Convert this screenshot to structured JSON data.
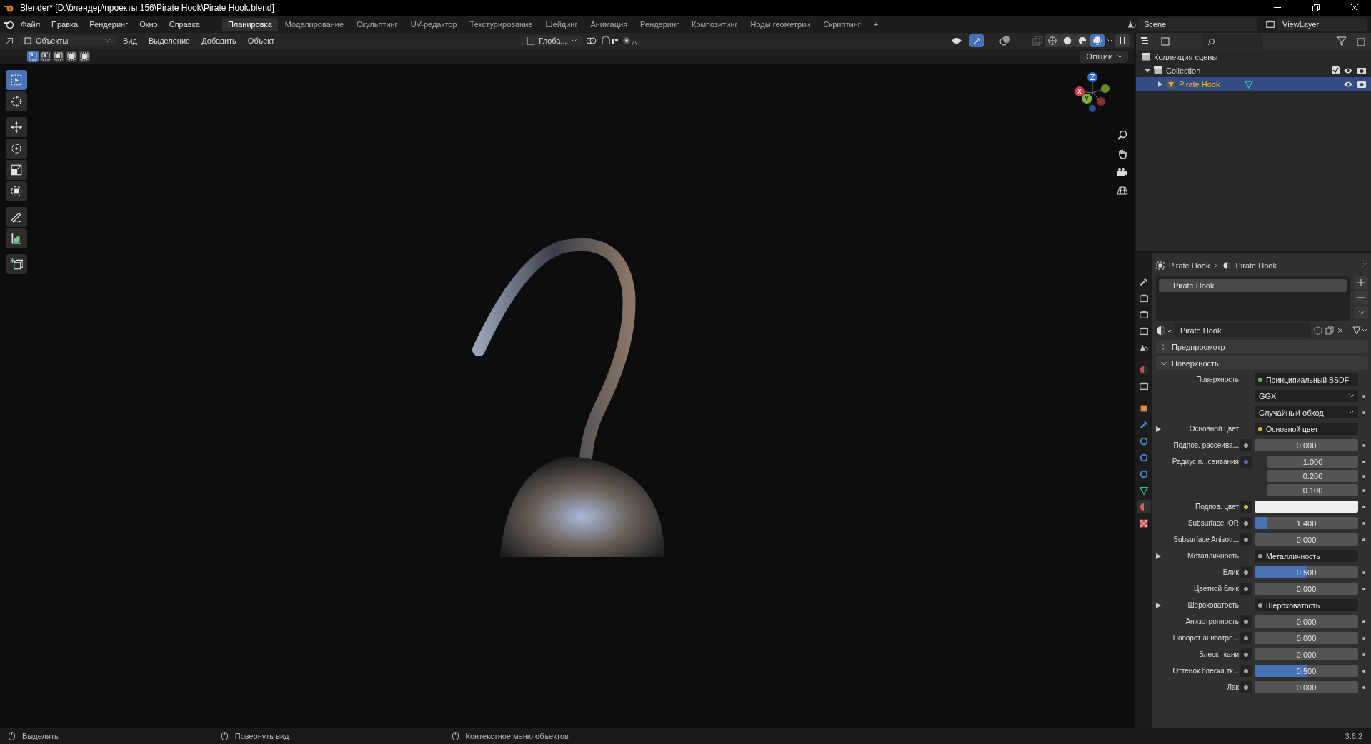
{
  "window": {
    "title": "Blender* [D:\\блендер\\проекты 156\\Pirate Hook\\Pirate Hook.blend]"
  },
  "menu": [
    "Файл",
    "Правка",
    "Рендеринг",
    "Окно",
    "Справка"
  ],
  "workspaces": [
    {
      "label": "Планировка",
      "selected": true
    },
    {
      "label": "Моделирование",
      "selected": false
    },
    {
      "label": "Скульптинг",
      "selected": false
    },
    {
      "label": "UV-редактор",
      "selected": false
    },
    {
      "label": "Текстурирование",
      "selected": false
    },
    {
      "label": "Шейдинг",
      "selected": false
    },
    {
      "label": "Анимация",
      "selected": false
    },
    {
      "label": "Рендеринг",
      "selected": false
    },
    {
      "label": "Композитинг",
      "selected": false
    },
    {
      "label": "Ноды геометрии",
      "selected": false
    },
    {
      "label": "Скриптинг",
      "selected": false
    }
  ],
  "add_workspace": "+",
  "scene": "Scene",
  "view_layer": "ViewLayer",
  "viewport": {
    "mode": "Объекты",
    "menus": [
      "Вид",
      "Выделение",
      "Добавить",
      "Объект"
    ],
    "orientation": "Глоба...",
    "options": "Опции",
    "select_modes": [
      {
        "selected": true
      },
      {
        "selected": false
      },
      {
        "selected": false
      },
      {
        "selected": false
      },
      {
        "selected": false
      }
    ],
    "shading": [
      {
        "kind": "wireframe",
        "selected": false
      },
      {
        "kind": "solid",
        "selected": false
      },
      {
        "kind": "material",
        "selected": false
      },
      {
        "kind": "rendered",
        "selected": true
      }
    ],
    "tools": [
      {
        "kind": "select",
        "selected": true
      },
      {
        "kind": "cursor",
        "selected": false
      },
      {
        "kind": "move",
        "selected": false
      },
      {
        "kind": "rotate",
        "selected": false
      },
      {
        "kind": "scale",
        "selected": false
      },
      {
        "kind": "transform",
        "selected": false
      },
      {
        "kind": "annotate",
        "selected": false
      },
      {
        "kind": "measure",
        "selected": false
      },
      {
        "kind": "add-cube",
        "selected": false
      }
    ],
    "gizmo": {
      "x": "X",
      "y": "Y",
      "z": "Z"
    }
  },
  "outliner": {
    "root": "Коллекция сцены",
    "items": [
      {
        "label": "Collection",
        "selected": false,
        "expanded": true,
        "children": [
          {
            "label": "Pirate Hook",
            "selected": true,
            "expanded": false
          }
        ]
      }
    ]
  },
  "properties": {
    "tabs": [
      {
        "kind": "tool",
        "selected": false
      },
      {
        "kind": "render",
        "selected": false
      },
      {
        "kind": "output",
        "selected": false
      },
      {
        "kind": "view-layer",
        "selected": false
      },
      {
        "kind": "scene",
        "selected": false
      },
      {
        "kind": "world",
        "selected": false
      },
      {
        "kind": "collection",
        "selected": false
      },
      {
        "kind": "object",
        "selected": false
      },
      {
        "kind": "modifier",
        "selected": false
      },
      {
        "kind": "particles",
        "selected": false
      },
      {
        "kind": "physics",
        "selected": false
      },
      {
        "kind": "constraints",
        "selected": false
      },
      {
        "kind": "data",
        "selected": false
      },
      {
        "kind": "material",
        "selected": true
      },
      {
        "kind": "texture",
        "selected": false
      }
    ],
    "breadcrumb": [
      "Pirate Hook",
      "Pirate Hook"
    ],
    "slots": [
      {
        "label": "Pirate Hook",
        "selected": true
      }
    ],
    "material": "Pirate Hook",
    "panels": [
      {
        "label": "Предпросмотр",
        "expanded": false
      },
      {
        "label": "Поверхность",
        "expanded": true
      }
    ],
    "rows": [
      {
        "kind": "link",
        "label": "Поверхность",
        "value": "Принципиальный BSDF",
        "color": "#4cc04c"
      },
      {
        "kind": "dropdown",
        "value": "GGX"
      },
      {
        "kind": "dropdown",
        "value": "Случайный обход"
      },
      {
        "kind": "link",
        "label": "Основной цвет",
        "value": "Основной цвет",
        "color": "#c7c729",
        "expandable": true
      },
      {
        "kind": "number",
        "label": "Подпов. рассеива...",
        "value": "0.000",
        "level": 0,
        "color": "#a1a1a1"
      },
      {
        "kind": "vector",
        "label": "Радиус п...сеивания",
        "values": [
          "1.000",
          "0.200",
          "0.100"
        ],
        "color": "#6363c7"
      },
      {
        "kind": "color",
        "label": "Подпов. цвет",
        "color": "#c7c729"
      },
      {
        "kind": "number",
        "label": "Subsurface IOR",
        "value": "1.400",
        "level": 0.12,
        "color": "#a1a1a1"
      },
      {
        "kind": "number",
        "label": "Subsurface Anisotr...",
        "value": "0.000",
        "level": 0,
        "color": "#a1a1a1"
      },
      {
        "kind": "link",
        "label": "Металличность",
        "value": "Металличность",
        "color": "#a1a1a1",
        "expandable": true
      },
      {
        "kind": "number",
        "label": "Блик",
        "value": "0.500",
        "level": 0.5,
        "color": "#a1a1a1"
      },
      {
        "kind": "number",
        "label": "Цветной блик",
        "value": "0.000",
        "level": 0,
        "color": "#a1a1a1"
      },
      {
        "kind": "link",
        "label": "Шероховатость",
        "value": "Шероховатость",
        "color": "#a1a1a1",
        "expandable": true
      },
      {
        "kind": "number",
        "label": "Анизотропность",
        "value": "0.000",
        "level": 0,
        "color": "#a1a1a1"
      },
      {
        "kind": "number",
        "label": "Поворот анизотро...",
        "value": "0.000",
        "level": 0,
        "color": "#a1a1a1"
      },
      {
        "kind": "number",
        "label": "Блеск ткани",
        "value": "0.000",
        "level": 0,
        "color": "#a1a1a1"
      },
      {
        "kind": "number",
        "label": "Оттенок блеска тк...",
        "value": "0.500",
        "level": 0.5,
        "color": "#a1a1a1"
      },
      {
        "kind": "number",
        "label": "Лак",
        "value": "0.000",
        "level": 0,
        "color": "#a1a1a1"
      }
    ]
  },
  "status_bar": {
    "hints": [
      "Выделить",
      "Повернуть вид",
      "Контекстное меню объектов"
    ],
    "version": "3.6.2"
  }
}
